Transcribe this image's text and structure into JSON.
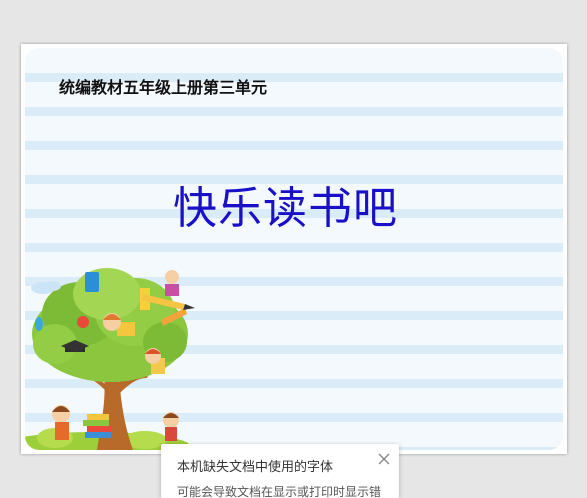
{
  "slide": {
    "subtitle": "统编教材五年级上册第三单元",
    "title": "快乐读书吧"
  },
  "notice": {
    "heading": "本机缺失文档中使用的字体",
    "body": "可能会导致文档在显示或打印时显示错",
    "close_icon": "close-icon"
  },
  "colors": {
    "background": "#e6e6e6",
    "slide_background": "#f3f9fd",
    "stripe": "#d9ecf8",
    "title": "#1a10c8"
  }
}
